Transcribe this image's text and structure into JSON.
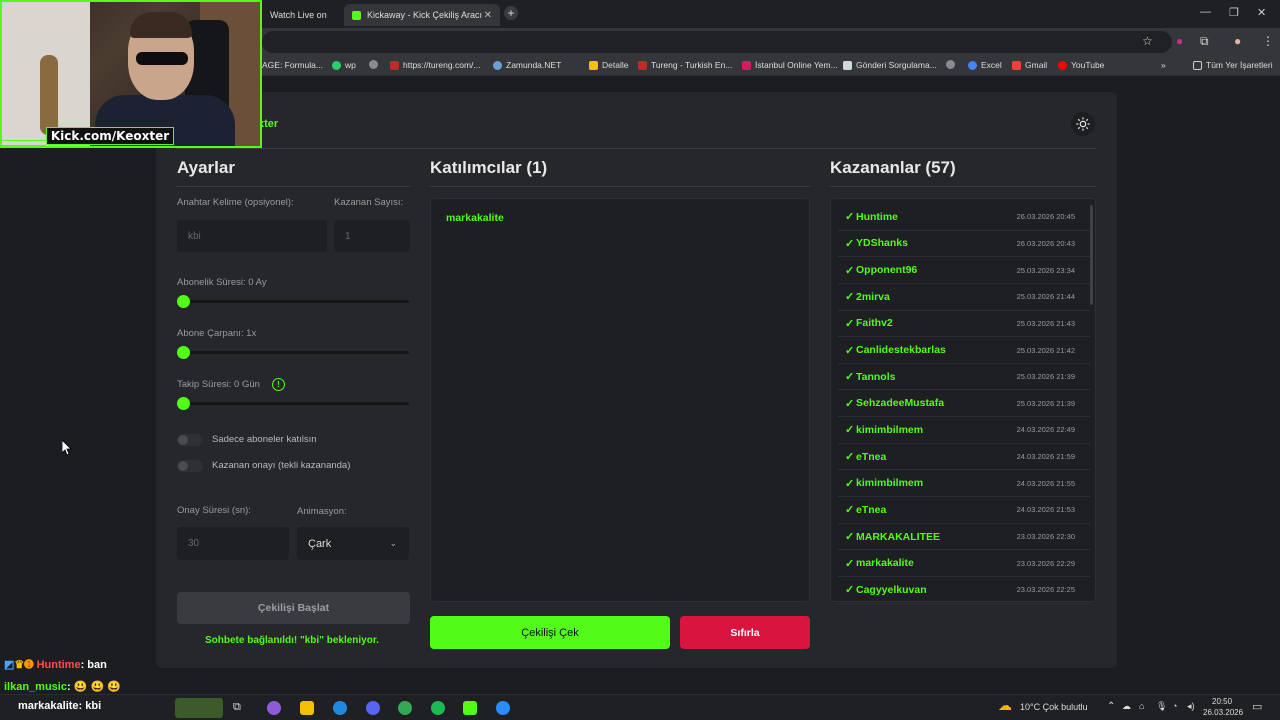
{
  "browser": {
    "tabs": [
      {
        "label": "Watch Live on",
        "active": false
      },
      {
        "label": "Kickaway - Kick Çekiliş Aracı",
        "active": true
      }
    ],
    "bookmarks": [
      {
        "label": "AGE: Formula...",
        "color": "#2b5bd7"
      },
      {
        "label": "wp",
        "color": "#25d366"
      },
      {
        "label": "",
        "color": "#8a8b8e"
      },
      {
        "label": "https://tureng.com/...",
        "color": "#c62828"
      },
      {
        "label": "Zamunda.NET",
        "color": "#6aa0d8"
      },
      {
        "label": "Detalle",
        "color": "#f2c200"
      },
      {
        "label": "Tureng - Turkish En...",
        "color": "#c62828"
      },
      {
        "label": "İstanbul Online Yem...",
        "color": "#d81b60"
      },
      {
        "label": "Gönderi Sorgulama...",
        "color": "#cfd8dc"
      },
      {
        "label": "",
        "color": "#8a8b8e"
      },
      {
        "label": "Excel",
        "color": "#4285f4"
      },
      {
        "label": "Gmail",
        "color": "#ea4335"
      },
      {
        "label": "YouTube",
        "color": "#ff0000"
      }
    ],
    "all_bookmarks": "Tüm Yer İşaretleri"
  },
  "app": {
    "brand": "xter",
    "settings": {
      "title": "Ayarlar",
      "keyword_label": "Anahtar Kelime (opsiyonel):",
      "keyword_placeholder": "kbi",
      "winner_count_label": "Kazanan Sayısı:",
      "winner_count_value": "1",
      "sub_duration_label": "Abonelik Süresi: 0 Ay",
      "sub_multiplier_label": "Abone Çarpanı: 1x",
      "follow_duration_label": "Takip Süresi:  0  Gün",
      "toggle_subs_only": "Sadece aboneler katılsın",
      "toggle_winner_confirm": "Kazanan onayı (tekli kazananda)",
      "confirm_time_label": "Onay Süresi (sn):",
      "confirm_time_value": "30",
      "animation_label": "Animasyon:",
      "animation_value": "Çark",
      "start_button": "Çekilişi Başlat",
      "status_text": "Sohbete bağlanıldı! \"kbi\" bekleniyor."
    },
    "participants": {
      "title": "Katılımcılar (1)",
      "items": [
        "markakalite"
      ],
      "draw_button": "Çekilişi Çek",
      "reset_button": "Sıfırla"
    },
    "winners": {
      "title": "Kazananlar (57)",
      "items": [
        {
          "name": "Huntime",
          "date": "26.03.2026 20:45"
        },
        {
          "name": "YDShanks",
          "date": "26.03.2026 20:43"
        },
        {
          "name": "Opponent96",
          "date": "25.03.2026 23:34"
        },
        {
          "name": "2mirva",
          "date": "25.03.2026 21:44"
        },
        {
          "name": "Faithv2",
          "date": "25.03.2026 21:43"
        },
        {
          "name": "Canlidestekbarlas",
          "date": "25.03.2026 21:42"
        },
        {
          "name": "Tannols",
          "date": "25.03.2026 21:39"
        },
        {
          "name": "SehzadeeMustafa",
          "date": "25.03.2026 21:39"
        },
        {
          "name": "kimimbilmem",
          "date": "24.03.2026 22:49"
        },
        {
          "name": "eTnea",
          "date": "24.03.2026 21:59"
        },
        {
          "name": "kimimbilmem",
          "date": "24.03.2026 21:55"
        },
        {
          "name": "eTnea",
          "date": "24.03.2026 21:53"
        },
        {
          "name": "MARKAKALITEE",
          "date": "23.03.2026 22:30"
        },
        {
          "name": "markakalite",
          "date": "23.03.2026 22:29"
        },
        {
          "name": "Cagyyelkuvan",
          "date": "23.03.2026 22:25"
        }
      ]
    }
  },
  "stream": {
    "kick_label": "Kick.com/Keoxter",
    "chat": [
      {
        "user": "Huntime",
        "message": ": ban",
        "user_color": "#ff4d4d"
      },
      {
        "user": "ilkan_music",
        "message": ": 😃 😃 😃",
        "user_color": "#53fc18"
      },
      {
        "user": "markakalite",
        "message": ": kbi",
        "user_color": "#ffffff"
      }
    ]
  },
  "taskbar": {
    "weather": "10°C  Çok bulutlu",
    "time": "20:50",
    "date": "26.03.2026"
  }
}
